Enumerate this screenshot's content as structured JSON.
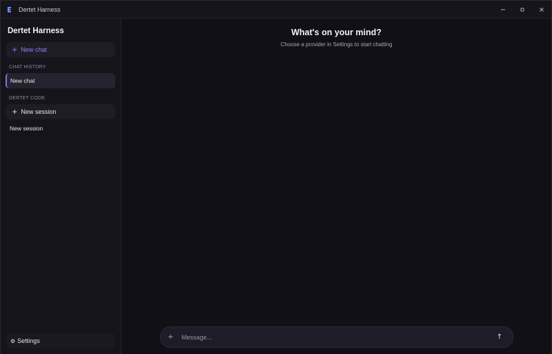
{
  "window": {
    "title": "Dertet Harness",
    "controls": [
      "minimize",
      "maximize",
      "close"
    ]
  },
  "sidebar": {
    "brand": "Dertet Harness",
    "new_chat_label": "New chat",
    "chat_history_label": "CHAT HISTORY",
    "chat_history": [
      {
        "label": "New chat",
        "active": true
      }
    ],
    "code_section_label": "DERTET CODE",
    "new_session_label": "New session",
    "sessions": [
      {
        "label": "New session"
      }
    ],
    "settings_label": "Settings"
  },
  "main": {
    "heading": "What's on your mind?",
    "subheading": "Choose a provider in Settings to start chatting",
    "composer": {
      "placeholder": "Message...",
      "value": ""
    }
  },
  "colors": {
    "accent": "#8b6cf4",
    "background": "#111016",
    "sidebar": "#15141b"
  }
}
